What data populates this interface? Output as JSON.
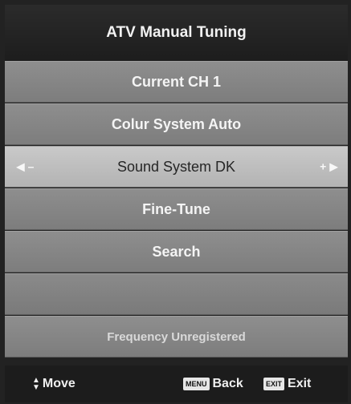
{
  "title": "ATV Manual Tuning",
  "menu": {
    "current_ch": "Current CH 1",
    "colour_system": "Colur System Auto",
    "sound_system": "Sound System DK",
    "fine_tune": "Fine-Tune",
    "search": "Search",
    "status": "Frequency Unregistered"
  },
  "arrows": {
    "left": "◀ –",
    "right": "+ ▶"
  },
  "footer": {
    "move_label": "Move",
    "menu_key": "MENU",
    "back_label": "Back",
    "exit_key": "EXIT",
    "exit_label": "Exit"
  },
  "icons": {
    "move": "up-down-arrows-icon",
    "left": "left-arrow-icon",
    "right": "right-arrow-icon"
  }
}
